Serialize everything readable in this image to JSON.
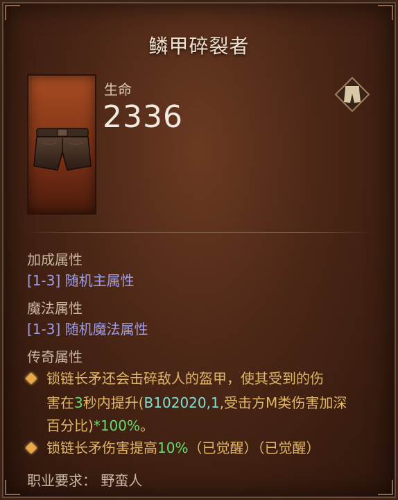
{
  "item": {
    "name": "鳞甲碎裂者",
    "stat_label": "生命",
    "stat_value": "2336",
    "slot_icon": "pants-icon"
  },
  "bonus": {
    "heading": "加成属性",
    "affix": "[1-3] 随机主属性"
  },
  "magic": {
    "heading": "魔法属性",
    "affix": "[1-3] 随机魔法属性"
  },
  "legendary": {
    "heading": "传奇属性",
    "line1": "锁链长矛还会击碎敌人的盔甲，使其受到的伤",
    "line2_a": "害在",
    "line2_num": "3",
    "line2_b": "秒内提升(",
    "line2_code": "B102020,1",
    "line2_c": ",受击方M类伤害加深",
    "line3_a": "百分比)",
    "line3_pct": "*100%",
    "line3_b": "。",
    "line4_a": "锁链长矛伤害提高",
    "line4_pct": "10%",
    "line4_b": "（已觉醒）（已觉醒）"
  },
  "requirement": "职业要求：  野蛮人",
  "colors": {
    "legendary": "#e2b866",
    "magic": "#9e9ee8",
    "highlight_green": "#5ee06a"
  }
}
